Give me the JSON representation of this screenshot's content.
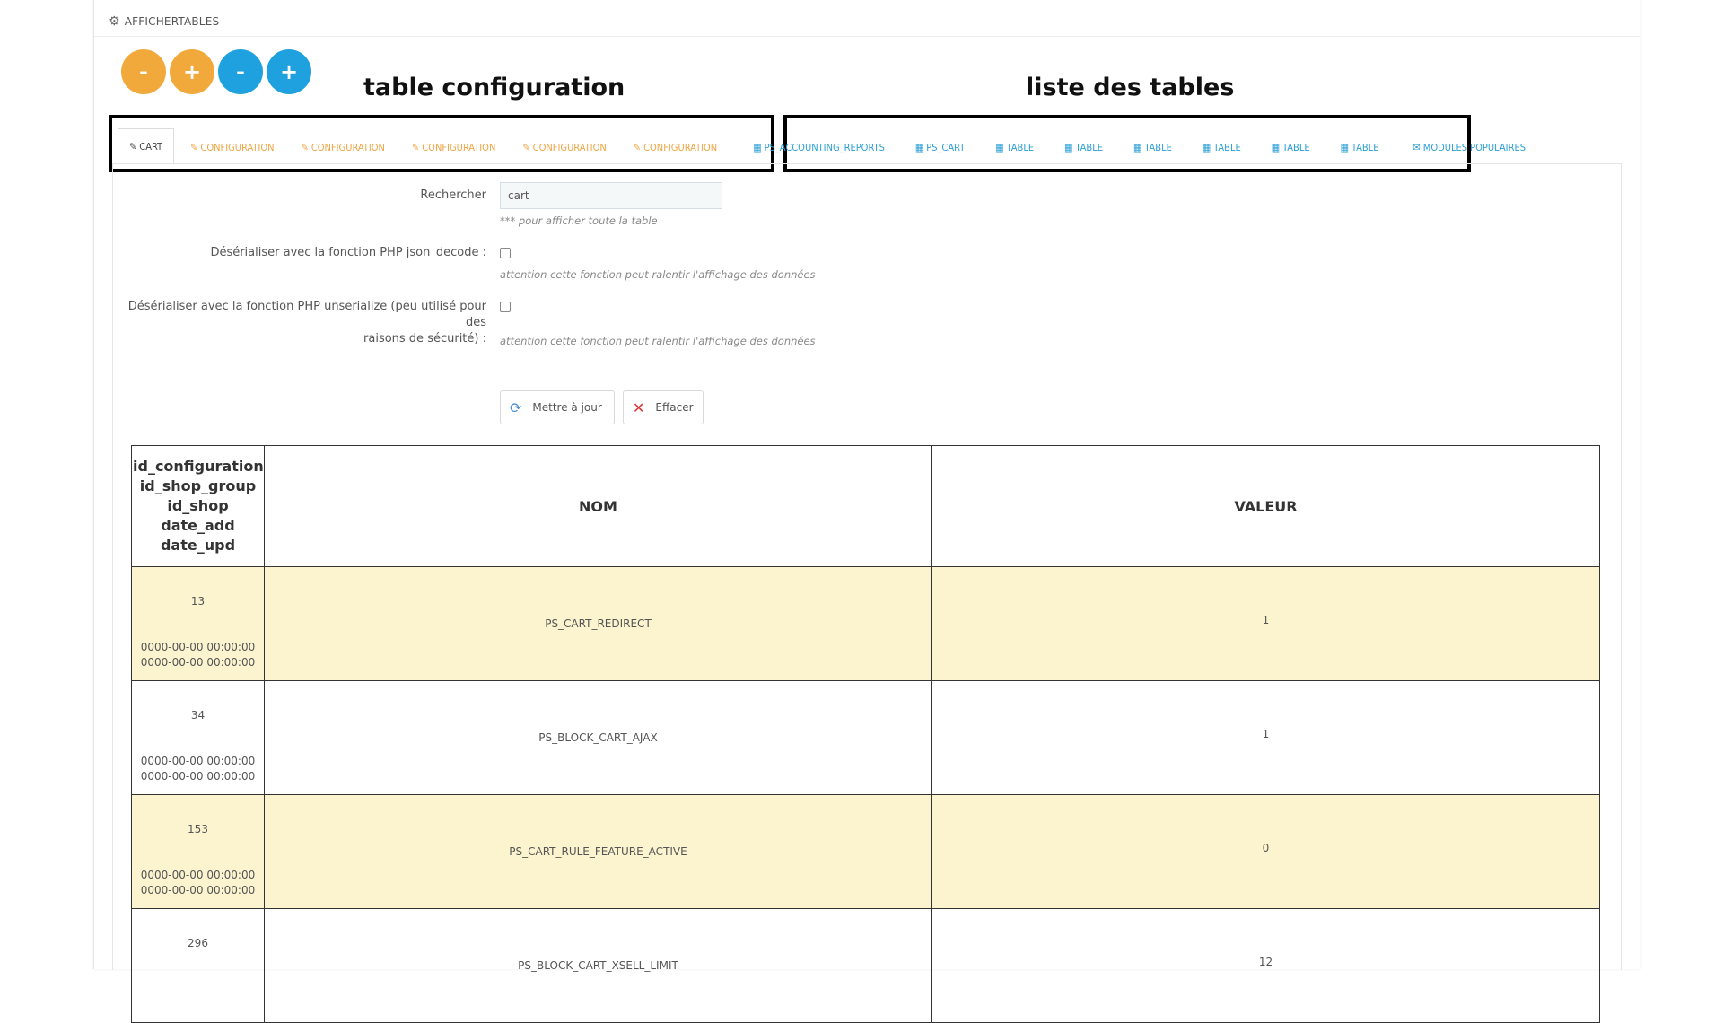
{
  "panel": {
    "title": "AFFICHERTABLES"
  },
  "buttons": [
    "-",
    "+",
    "-",
    "+"
  ],
  "annotations": {
    "left": "table configuration",
    "right": "liste des tables"
  },
  "tabs": {
    "config": [
      "CART",
      "CONFIGURATION",
      "CONFIGURATION",
      "CONFIGURATION",
      "CONFIGURATION",
      "CONFIGURATION"
    ],
    "tables": [
      "PS_ACCOUNTING_REPORTS",
      "PS_CART",
      "TABLE",
      "TABLE",
      "TABLE",
      "TABLE",
      "TABLE",
      "TABLE"
    ],
    "modules": "MODULES POPULAIRES"
  },
  "form": {
    "search_label": "Rechercher",
    "search_value": "cart",
    "search_help": "*** pour afficher toute la table",
    "json_label": "Désérialiser avec la fonction PHP json_decode :",
    "json_help": "attention cette fonction peut ralentir l'affichage des données",
    "unserialize_label_1": "Désérialiser avec la fonction PHP unserialize (peu utilisé pour des",
    "unserialize_label_2": "raisons de sécurité) :",
    "unserialize_help": "attention cette fonction peut ralentir l'affichage des données",
    "update_button": "Mettre à jour",
    "clear_button": "Effacer"
  },
  "table": {
    "headers": {
      "id_lines": [
        "id_configuration",
        "id_shop_group",
        "id_shop",
        "date_add",
        "date_upd"
      ],
      "nom": "NOM",
      "valeur": "VALEUR"
    },
    "rows": [
      {
        "id": "13",
        "date_add": "0000-00-00 00:00:00",
        "date_upd": "0000-00-00 00:00:00",
        "nom": "PS_CART_REDIRECT",
        "valeur": "1"
      },
      {
        "id": "34",
        "date_add": "0000-00-00 00:00:00",
        "date_upd": "0000-00-00 00:00:00",
        "nom": "PS_BLOCK_CART_AJAX",
        "valeur": "1"
      },
      {
        "id": "153",
        "date_add": "0000-00-00 00:00:00",
        "date_upd": "0000-00-00 00:00:00",
        "nom": "PS_CART_RULE_FEATURE_ACTIVE",
        "valeur": "0"
      },
      {
        "id": "296",
        "date_add": "",
        "date_upd": "",
        "nom": "PS_BLOCK_CART_XSELL_LIMIT",
        "valeur": "12"
      }
    ]
  },
  "colors": {
    "orange": "#f2a93b",
    "blue": "#1fa1e0",
    "tab_config": "#f0a543",
    "tab_table": "#2a9fd6",
    "row_highlight": "#fcf4cf"
  }
}
